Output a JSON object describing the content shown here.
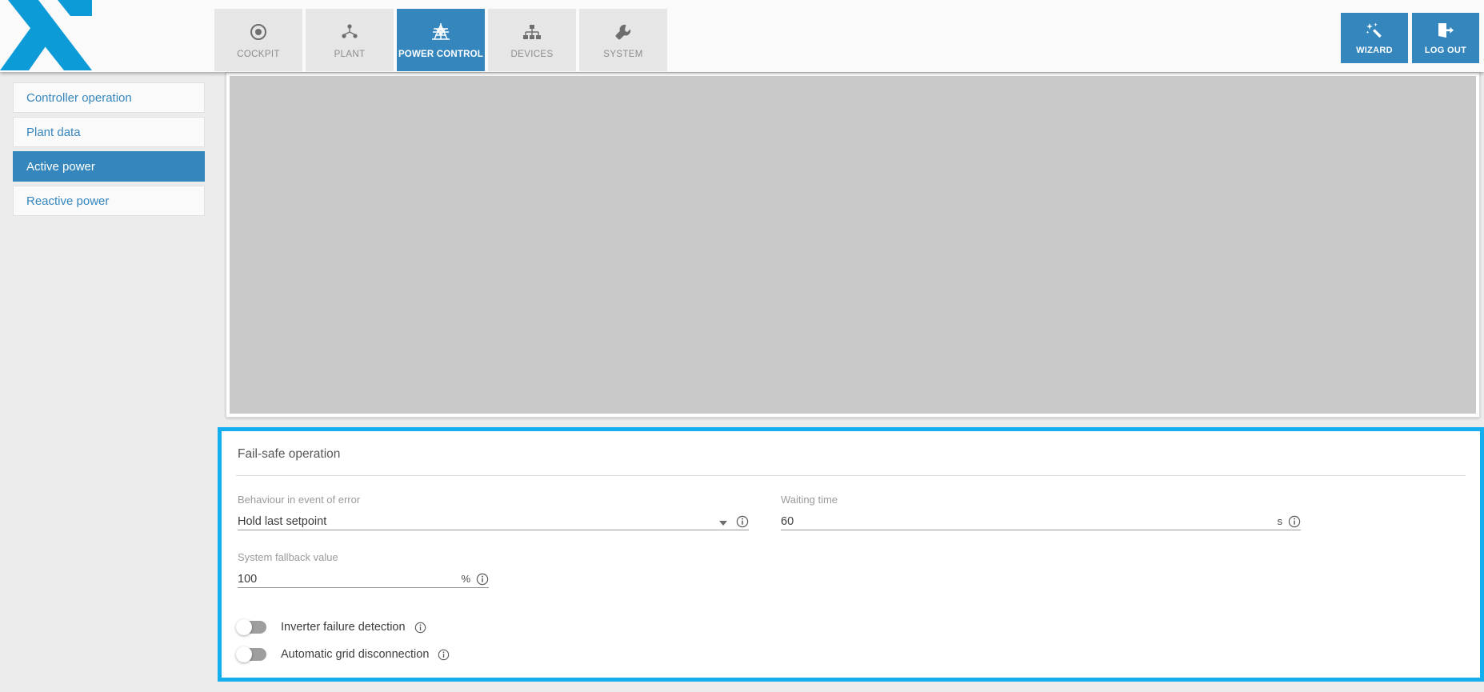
{
  "header": {
    "logo_name": "x-logo",
    "tabs": [
      {
        "label": "COCKPIT",
        "icon": "target-icon",
        "active": false
      },
      {
        "label": "PLANT",
        "icon": "plant-network-icon",
        "active": false
      },
      {
        "label": "POWER CONTROL",
        "icon": "transmission-tower-icon",
        "active": true
      },
      {
        "label": "DEVICES",
        "icon": "device-tree-icon",
        "active": false
      },
      {
        "label": "SYSTEM",
        "icon": "wrench-icon",
        "active": false
      }
    ],
    "actions": [
      {
        "label": "WIZARD",
        "icon": "magic-wand-icon"
      },
      {
        "label": "LOG OUT",
        "icon": "logout-door-icon"
      }
    ]
  },
  "sidebar": {
    "items": [
      {
        "label": "Controller operation",
        "active": false
      },
      {
        "label": "Plant data",
        "active": false
      },
      {
        "label": "Active power",
        "active": true
      },
      {
        "label": "Reactive power",
        "active": false
      }
    ]
  },
  "main": {
    "failsafe": {
      "title": "Fail-safe operation",
      "behaviour": {
        "label": "Behaviour in event of error",
        "value": "Hold last setpoint",
        "options": [
          "Hold last setpoint"
        ]
      },
      "waiting_time": {
        "label": "Waiting time",
        "value": "60",
        "unit": "s"
      },
      "fallback_value": {
        "label": "System fallback value",
        "value": "100",
        "unit": "%"
      },
      "toggles": [
        {
          "label": "Inverter failure detection",
          "state": "off"
        },
        {
          "label": "Automatic grid disconnection",
          "state": "off"
        }
      ]
    }
  },
  "colors": {
    "brand_blue": "#3586bd",
    "highlight_cyan": "#13aeed",
    "logo_blue": "#0d9bd8",
    "panel_gray": "#c9c9c9",
    "page_bg": "#ececec"
  }
}
